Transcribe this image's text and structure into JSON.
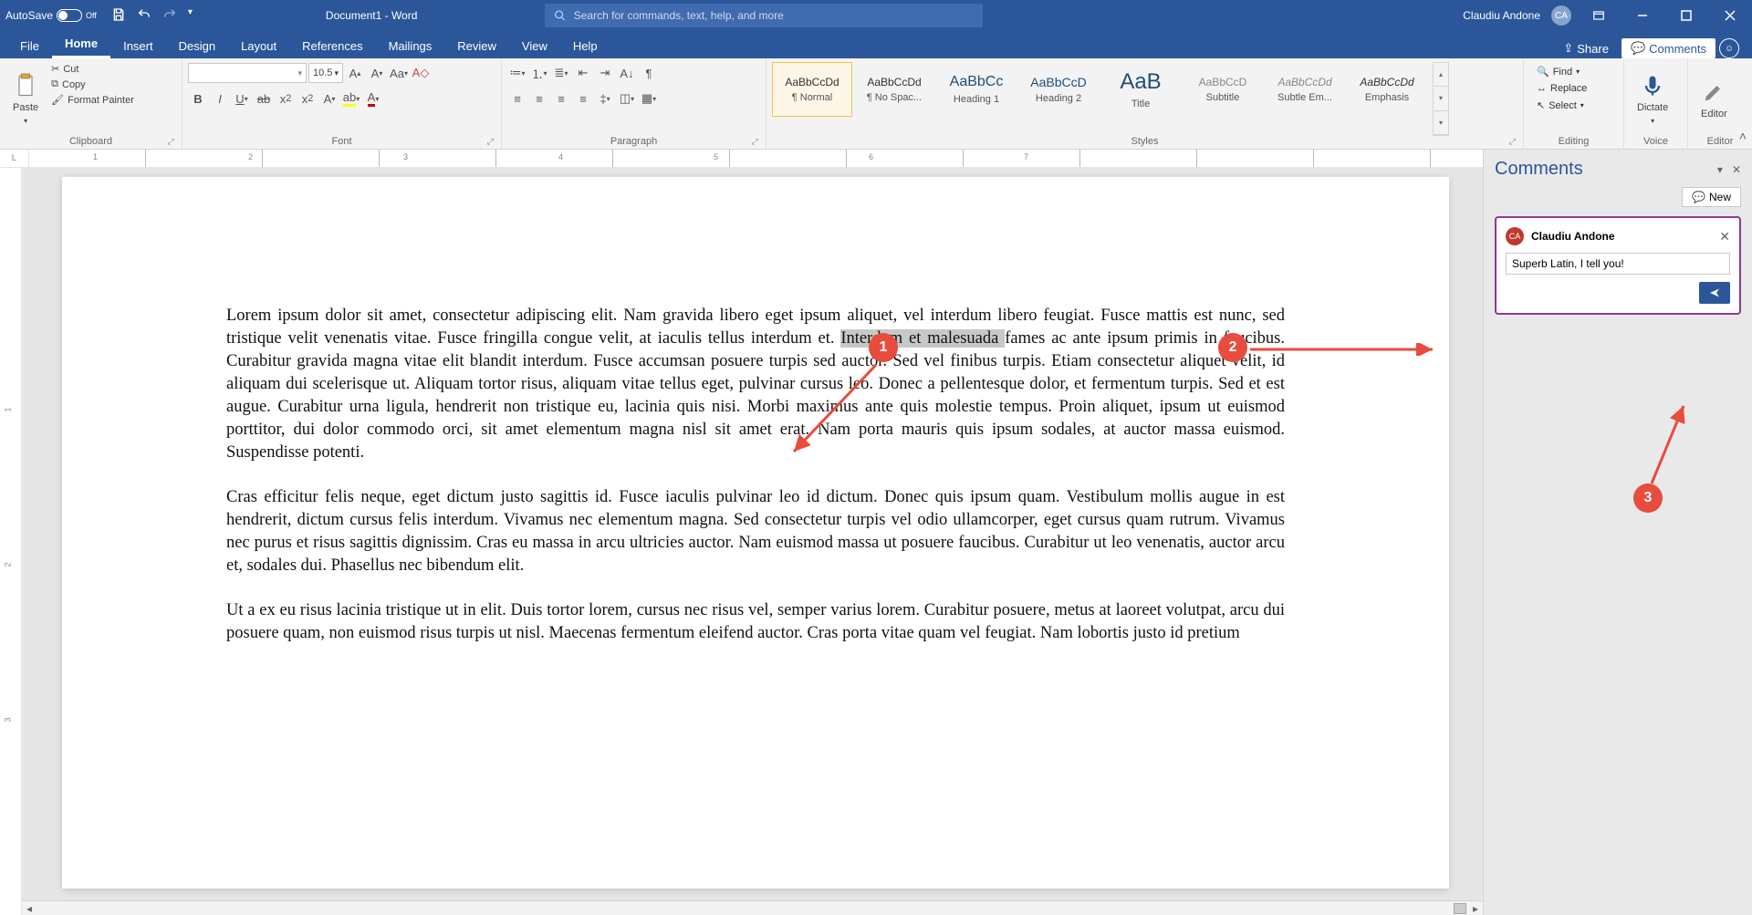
{
  "title_bar": {
    "autosave_label": "AutoSave",
    "autosave_state": "Off",
    "doc_title": "Document1 - Word",
    "search_placeholder": "Search for commands, text, help, and more",
    "user_name": "Claudiu Andone",
    "user_initials": "CA"
  },
  "tabs": [
    "File",
    "Home",
    "Insert",
    "Design",
    "Layout",
    "References",
    "Mailings",
    "Review",
    "View",
    "Help"
  ],
  "active_tab": "Home",
  "share_label": "Share",
  "comments_label": "Comments",
  "ribbon": {
    "clipboard": {
      "label": "Clipboard",
      "paste": "Paste",
      "cut": "Cut",
      "copy": "Copy",
      "format_painter": "Format Painter"
    },
    "font": {
      "label": "Font",
      "size": "10.5"
    },
    "paragraph": {
      "label": "Paragraph"
    },
    "styles": {
      "label": "Styles",
      "items": [
        {
          "sample": "AaBbCcDd",
          "name": "¶ Normal"
        },
        {
          "sample": "AaBbCcDd",
          "name": "¶ No Spac..."
        },
        {
          "sample": "AaBbCc",
          "name": "Heading 1"
        },
        {
          "sample": "AaBbCcD",
          "name": "Heading 2"
        },
        {
          "sample": "AaB",
          "name": "Title"
        },
        {
          "sample": "AaBbCcD",
          "name": "Subtitle"
        },
        {
          "sample": "AaBbCcDd",
          "name": "Subtle Em..."
        },
        {
          "sample": "AaBbCcDd",
          "name": "Emphasis"
        }
      ]
    },
    "editing": {
      "label": "Editing",
      "find": "Find",
      "replace": "Replace",
      "select": "Select"
    },
    "voice": {
      "label": "Voice",
      "dictate": "Dictate"
    },
    "editor": {
      "label": "Editor",
      "editor": "Editor"
    }
  },
  "ruler_marks": [
    "1",
    "2",
    "3",
    "4",
    "5",
    "6",
    "7"
  ],
  "vruler_marks": [
    "1",
    "2",
    "3"
  ],
  "document": {
    "p1_a": "Lorem ipsum dolor sit amet, consectetur adipiscing elit. Nam gravida libero eget ipsum aliquet, vel interdum libero feugiat. Fusce mattis est nunc, sed tristique velit venenatis vitae. Fusce fringilla congue velit, at iaculis tellus interdum et. ",
    "p1_hl": "Interdum et malesuada ",
    "p1_b": "fames ac ante ipsum primis in faucibus. Curabitur gravida magna vitae elit blandit interdum. Fusce accumsan posuere turpis sed auctor. Sed vel finibus turpis. Etiam consectetur aliquet velit, id aliquam dui scelerisque ut. Aliquam tortor risus, aliquam vitae tellus eget, pulvinar cursus leo. Donec a pellentesque dolor, et fermentum turpis. Sed et est augue. Curabitur urna ligula, hendrerit non tristique eu, lacinia quis nisi. Morbi maximus ante quis molestie tempus. Proin aliquet, ipsum ut euismod porttitor, dui dolor commodo orci, sit amet elementum magna nisl sit amet erat. Nam porta mauris quis ipsum sodales, at auctor massa euismod. Suspendisse potenti.",
    "p2": "Cras efficitur felis neque, eget dictum justo sagittis id. Fusce iaculis pulvinar leo id dictum. Donec quis ipsum quam. Vestibulum mollis augue in est hendrerit, dictum cursus felis interdum. Vivamus nec elementum magna. Sed consectetur turpis vel odio ullamcorper, eget cursus quam rutrum. Vivamus nec purus et risus sagittis dignissim. Cras eu massa in arcu ultricies auctor. Nam euismod massa ut posuere faucibus. Curabitur ut leo venenatis, auctor arcu et, sodales dui. Phasellus nec bibendum elit.",
    "p3": "Ut a ex eu risus lacinia tristique ut in elit. Duis tortor lorem, cursus nec risus vel, semper varius lorem. Curabitur posuere, metus at laoreet volutpat, arcu dui posuere quam, non euismod risus turpis ut nisl. Maecenas fermentum eleifend auctor. Cras porta vitae quam vel feugiat. Nam lobortis justo id pretium"
  },
  "comments_pane": {
    "title": "Comments",
    "new_label": "New",
    "author": "Claudiu Andone",
    "author_initials": "CA",
    "comment_text": "Superb Latin, I tell you!"
  },
  "markers": {
    "m1": "1",
    "m2": "2",
    "m3": "3"
  }
}
